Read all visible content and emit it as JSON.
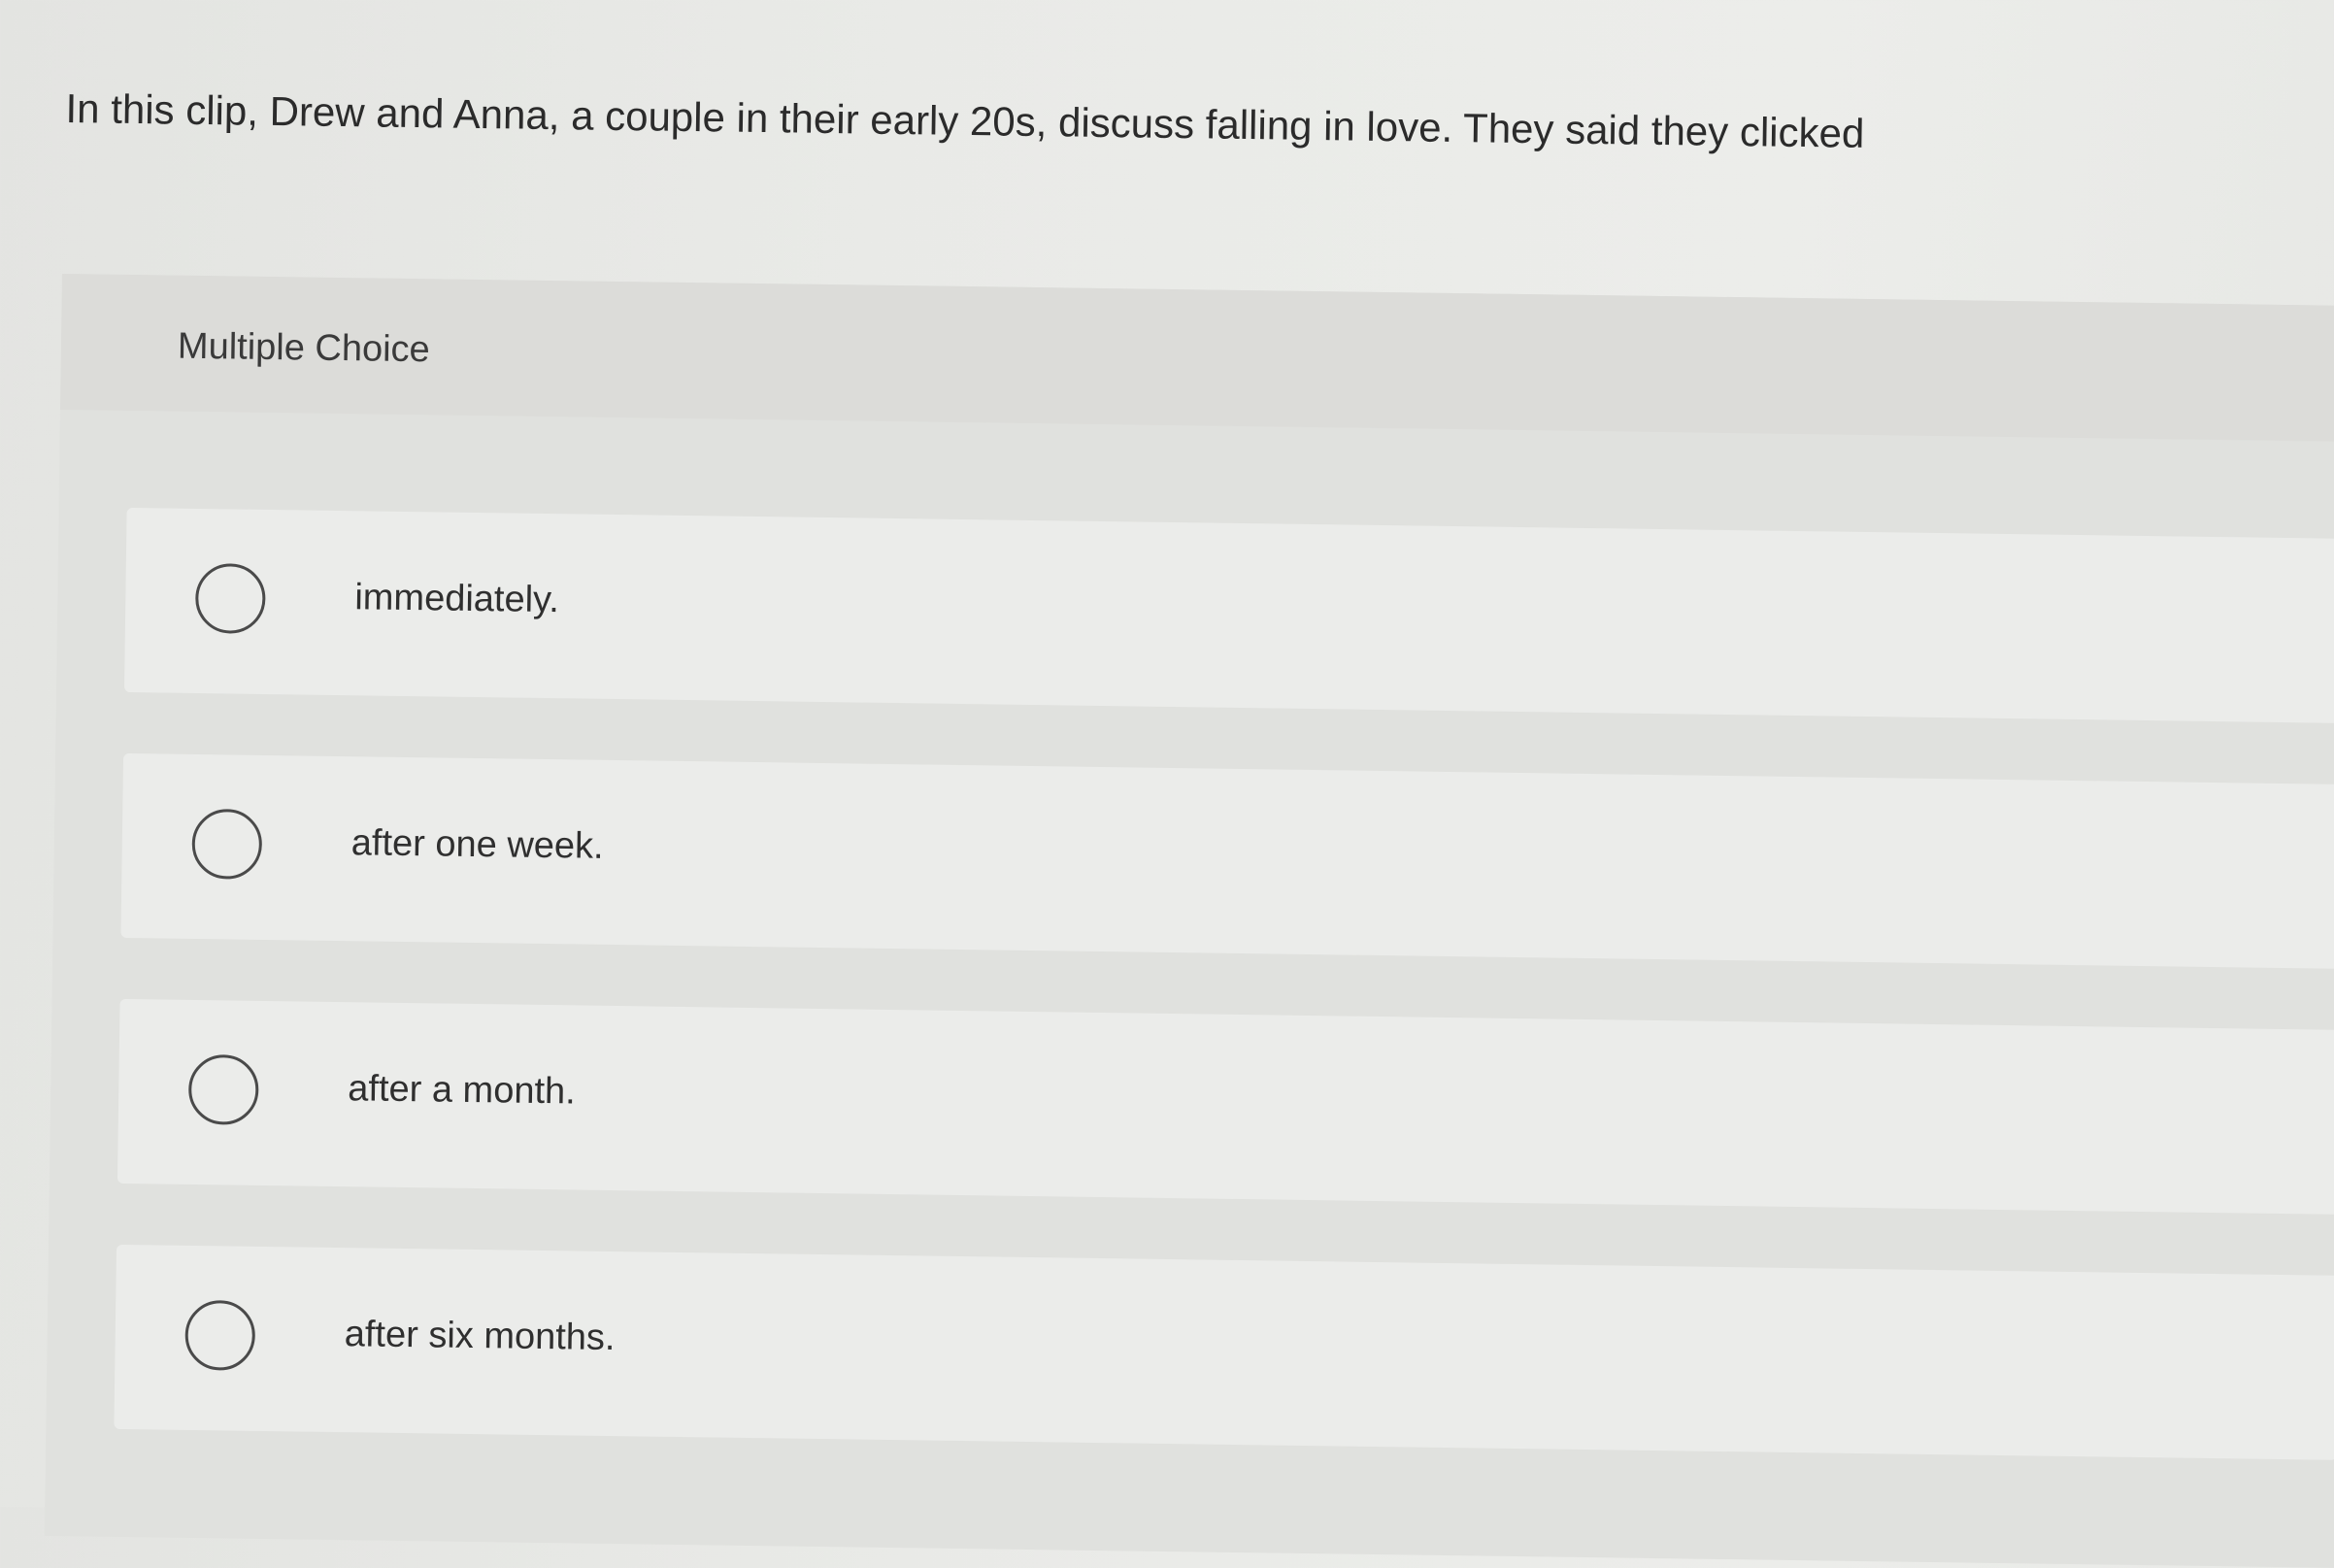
{
  "question": {
    "text": "In this clip, Drew and Anna, a couple in their early 20s, discuss falling in love. They said they clicked"
  },
  "answer_panel": {
    "type_label": "Multiple Choice",
    "options": [
      {
        "label": "immediately.",
        "selected": false
      },
      {
        "label": "after one week.",
        "selected": false
      },
      {
        "label": "after a month.",
        "selected": false
      },
      {
        "label": "after six months.",
        "selected": false
      }
    ]
  },
  "colors": {
    "background": "#e9eae7",
    "panel": "#e0e1de",
    "option_row": "#ebecea",
    "text": "#2f2f2f",
    "radio_border": "#4a4a4a"
  },
  "icons": {
    "radio": "radio-unselected-icon"
  }
}
